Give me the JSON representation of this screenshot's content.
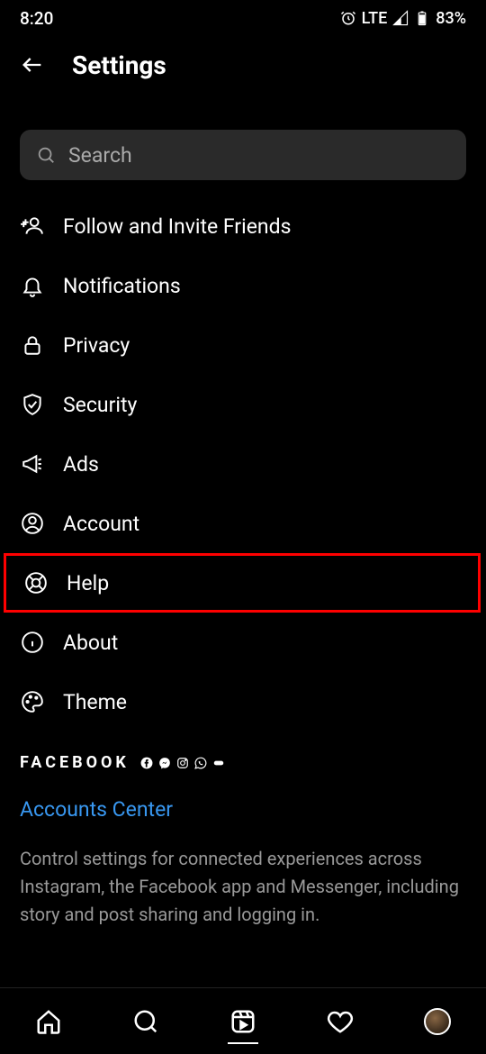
{
  "status": {
    "time": "8:20",
    "lte": "LTE",
    "battery": "83%"
  },
  "header": {
    "title": "Settings"
  },
  "search": {
    "placeholder": "Search"
  },
  "menu": [
    {
      "label": "Follow and Invite Friends"
    },
    {
      "label": "Notifications"
    },
    {
      "label": "Privacy"
    },
    {
      "label": "Security"
    },
    {
      "label": "Ads"
    },
    {
      "label": "Account"
    },
    {
      "label": "Help"
    },
    {
      "label": "About"
    },
    {
      "label": "Theme"
    }
  ],
  "fb": {
    "logo": "FACEBOOK"
  },
  "accounts_center": {
    "title": "Accounts Center",
    "description": "Control settings for connected experiences across Instagram, the Facebook app and Messenger, including story and post sharing and logging in."
  }
}
